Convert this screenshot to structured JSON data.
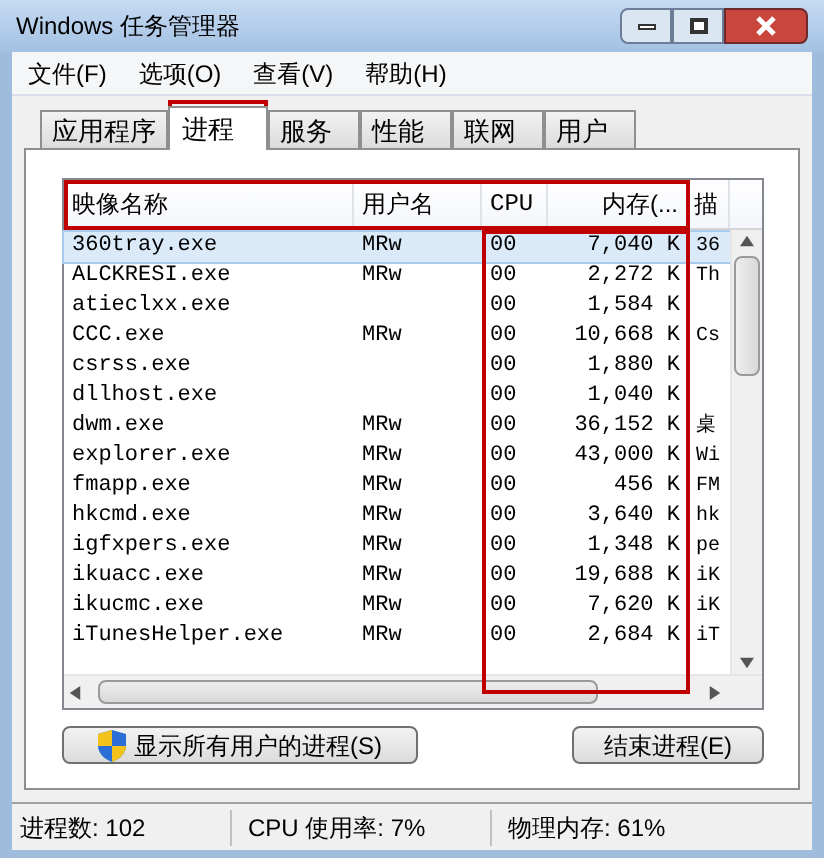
{
  "window": {
    "title": "Windows 任务管理器"
  },
  "menu": [
    "文件(F)",
    "选项(O)",
    "查看(V)",
    "帮助(H)"
  ],
  "tabs": [
    {
      "label": "应用程序",
      "selected": false
    },
    {
      "label": "进程",
      "selected": true
    },
    {
      "label": "服务",
      "selected": false
    },
    {
      "label": "性能",
      "selected": false
    },
    {
      "label": "联网",
      "selected": false
    },
    {
      "label": "用户",
      "selected": false
    }
  ],
  "table": {
    "columns": [
      "映像名称",
      "用户名",
      "CPU",
      "内存(...",
      "描"
    ],
    "rows": [
      {
        "name": "360tray.exe",
        "user": "MRw",
        "cpu": "00",
        "memory": "7,040 K",
        "column_5": "36",
        "selected": true
      },
      {
        "name": "ALCKRESI.exe",
        "user": "MRw",
        "cpu": "00",
        "memory": "2,272 K",
        "column_5": "Th",
        "selected": false
      },
      {
        "name": "atieclxx.exe",
        "user": "",
        "cpu": "00",
        "memory": "1,584 K",
        "column_5": "",
        "selected": false
      },
      {
        "name": "CCC.exe",
        "user": "MRw",
        "cpu": "00",
        "memory": "10,668 K",
        "column_5": "Cs",
        "selected": false
      },
      {
        "name": "csrss.exe",
        "user": "",
        "cpu": "00",
        "memory": "1,880 K",
        "column_5": "",
        "selected": false
      },
      {
        "name": "dllhost.exe",
        "user": "",
        "cpu": "00",
        "memory": "1,040 K",
        "column_5": "",
        "selected": false
      },
      {
        "name": "dwm.exe",
        "user": "MRw",
        "cpu": "00",
        "memory": "36,152 K",
        "column_5": "桌",
        "selected": false
      },
      {
        "name": "explorer.exe",
        "user": "MRw",
        "cpu": "00",
        "memory": "43,000 K",
        "column_5": "Wi",
        "selected": false
      },
      {
        "name": "fmapp.exe",
        "user": "MRw",
        "cpu": "00",
        "memory": "456 K",
        "column_5": "FM",
        "selected": false
      },
      {
        "name": "hkcmd.exe",
        "user": "MRw",
        "cpu": "00",
        "memory": "3,640 K",
        "column_5": "hk",
        "selected": false
      },
      {
        "name": "igfxpers.exe",
        "user": "MRw",
        "cpu": "00",
        "memory": "1,348 K",
        "column_5": "pe",
        "selected": false
      },
      {
        "name": "ikuacc.exe",
        "user": "MRw",
        "cpu": "00",
        "memory": "19,688 K",
        "column_5": "iK",
        "selected": false
      },
      {
        "name": "ikucmc.exe",
        "user": "MRw",
        "cpu": "00",
        "memory": "7,620 K",
        "column_5": "iK",
        "selected": false
      },
      {
        "name": "iTunesHelper.exe",
        "user": "MRw",
        "cpu": "00",
        "memory": "2,684 K",
        "column_5": "iT",
        "selected": false
      }
    ]
  },
  "buttons": [
    "显示所有用户的进程(S)",
    "结束进程(E)"
  ],
  "status_bar": [
    "进程数: 102",
    "CPU 使用率: 7%",
    "物理内存: 61%"
  ]
}
